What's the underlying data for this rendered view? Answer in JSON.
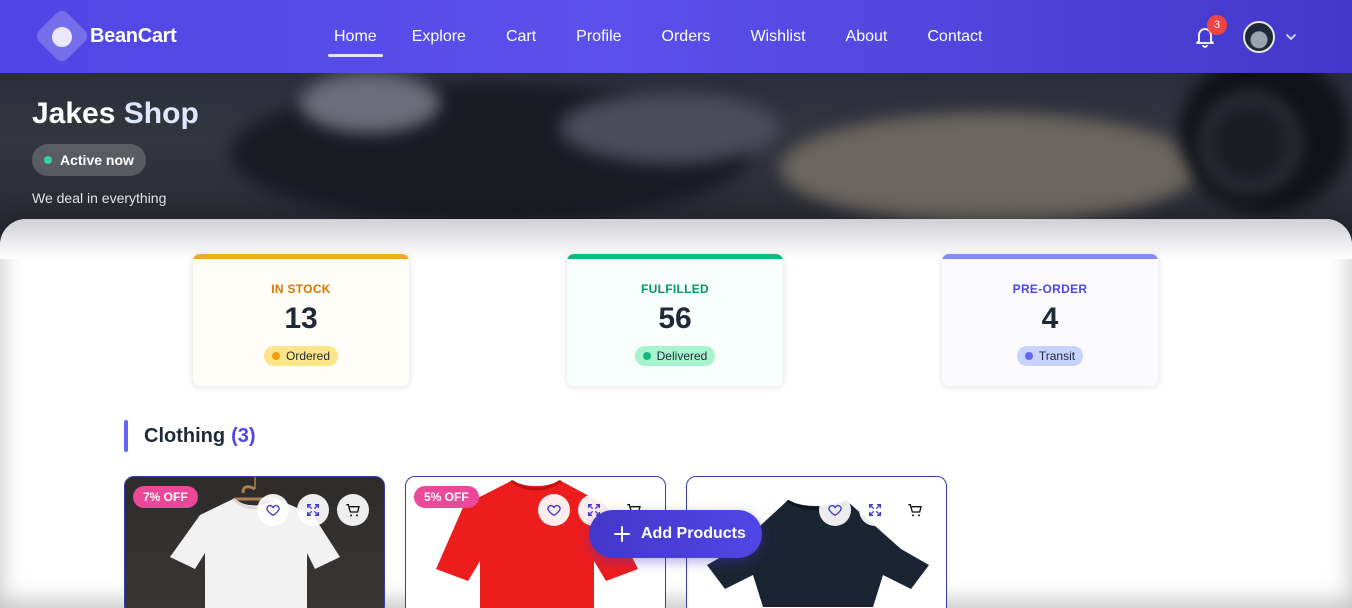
{
  "nav": {
    "brand": "BeanCart",
    "items": [
      {
        "label": "Home",
        "active": true
      },
      {
        "label": "Explore"
      },
      {
        "label": "Cart"
      },
      {
        "label": "Profile"
      },
      {
        "label": "Orders"
      },
      {
        "label": "Wishlist"
      },
      {
        "label": "About"
      },
      {
        "label": "Contact"
      }
    ],
    "notification_count": "3"
  },
  "hero": {
    "title_first": "Jakes",
    "title_second": "Shop",
    "status": "Active now",
    "tagline": "We deal in everything"
  },
  "stats": [
    {
      "label": "IN STOCK",
      "value": "13",
      "chip": "Ordered",
      "color": "#f59e0b"
    },
    {
      "label": "FULFILLED",
      "value": "56",
      "chip": "Delivered",
      "color": "#10b981"
    },
    {
      "label": "PRE-ORDER",
      "value": "4",
      "chip": "Transit",
      "color": "#6366f1"
    }
  ],
  "section": {
    "title": "Clothing",
    "count": "(3)"
  },
  "products": [
    {
      "discount": "7% OFF",
      "color": "white"
    },
    {
      "discount": "5% OFF",
      "color": "red"
    },
    {
      "discount": "",
      "color": "navy"
    }
  ],
  "fab": {
    "label": "Add Products"
  }
}
